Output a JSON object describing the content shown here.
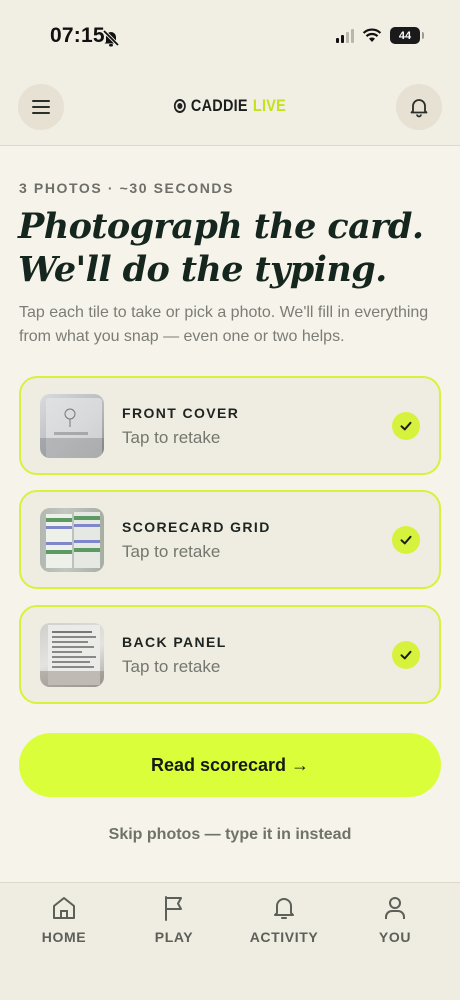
{
  "status_bar": {
    "time": "07:15",
    "battery": "44"
  },
  "header": {
    "logo_name": "CADDIE",
    "logo_live": "LIVE"
  },
  "intro": {
    "eyebrow": "3 PHOTOS · ~30 SECONDS",
    "headline_line1": "Photograph the card.",
    "headline_line2": "We'll do the typing.",
    "subtext": "Tap each tile to take or pick a photo. We'll fill in everything from what you snap — even one or two helps."
  },
  "tiles": [
    {
      "title": "FRONT COVER",
      "subtitle": "Tap to retake",
      "checked": true
    },
    {
      "title": "SCORECARD GRID",
      "subtitle": "Tap to retake",
      "checked": true
    },
    {
      "title": "BACK PANEL",
      "subtitle": "Tap to retake",
      "checked": true
    }
  ],
  "actions": {
    "primary_label": "Read scorecard →",
    "skip_label": "Skip photos — type it in instead"
  },
  "bottom_nav": [
    {
      "label": "HOME",
      "icon": "home-icon"
    },
    {
      "label": "PLAY",
      "icon": "flag-icon"
    },
    {
      "label": "ACTIVITY",
      "icon": "bell-icon"
    },
    {
      "label": "YOU",
      "icon": "person-icon"
    }
  ],
  "colors": {
    "accent": "#daff3a",
    "tile_border": "#d6f23c",
    "background": "#f6f3ea",
    "headline": "#15261e"
  }
}
